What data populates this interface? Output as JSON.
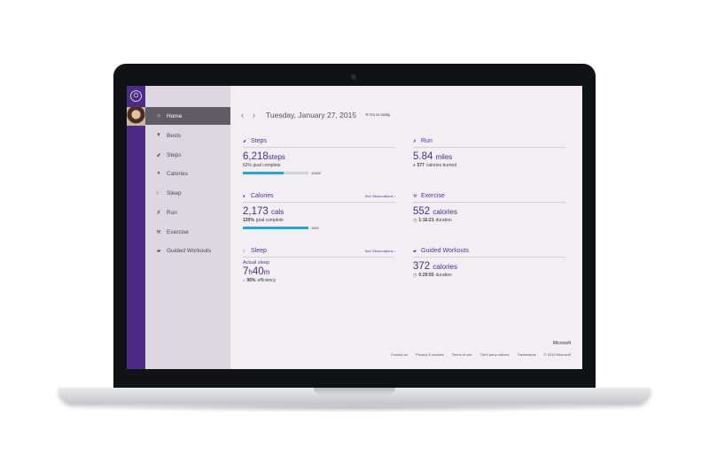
{
  "sidebar": {
    "rail_icon": "power-icon",
    "items": [
      {
        "label": "Home",
        "icon": "home-icon",
        "glyph": "⌂",
        "active": true
      },
      {
        "label": "Bests",
        "icon": "trophy-icon",
        "glyph": "🏆"
      },
      {
        "label": "Steps",
        "icon": "steps-icon",
        "glyph": "⬋"
      },
      {
        "label": "Calories",
        "icon": "flame-icon",
        "glyph": "♦"
      },
      {
        "label": "Sleep",
        "icon": "moon-icon",
        "glyph": "☾"
      },
      {
        "label": "Run",
        "icon": "run-icon",
        "glyph": "✗"
      },
      {
        "label": "Exercise",
        "icon": "dumbbell-icon",
        "glyph": "⚒"
      },
      {
        "label": "Guided Workouts",
        "icon": "clipboard-icon",
        "glyph": "▰"
      }
    ]
  },
  "header": {
    "prev": "‹",
    "next": "›",
    "date": "Tuesday, January 27, 2015",
    "today_link": "⟲ Go to today"
  },
  "cards": {
    "steps": {
      "title": "Steps",
      "value": "6,218",
      "unit": "steps",
      "goal_text": "62% goal complete",
      "goal_pct": "62%",
      "progress": 0.62,
      "goal": "10000"
    },
    "run": {
      "title": "Run",
      "value": "5.84",
      "unit": "miles",
      "sub_value": "577",
      "sub_text": "calories burned"
    },
    "calories": {
      "title": "Calories",
      "link": "See Observations ›",
      "value": "2,173",
      "unit": "cals",
      "goal_pct": "120%",
      "goal_text": "goal complete",
      "progress": 1.0,
      "goal": "1800"
    },
    "exercise": {
      "title": "Exercise",
      "value": "552",
      "unit": "calories",
      "sub_value": "1:16:21",
      "sub_text": "duration"
    },
    "sleep": {
      "title": "Sleep",
      "link": "See Observations ›",
      "label": "Actual sleep",
      "hours": "7",
      "h": "h",
      "minutes": "40",
      "m": "m",
      "sub_value": "96%",
      "sub_text": "efficiency"
    },
    "guided": {
      "title": "Guided Workouts",
      "value": "372",
      "unit": "calories",
      "sub_value": "0:29:55",
      "sub_text": "duration"
    }
  },
  "footer": {
    "brand": "Microsoft",
    "links": [
      "Contact us",
      "Privacy & cookies",
      "Terms of use",
      "Third party notices",
      "Trademarks",
      "© 2015 Microsoft"
    ]
  },
  "colors": {
    "accent": "#4b2b84",
    "progress": "#2aa3cf",
    "sidebar": "#dcd7e0",
    "active_nav": "#605c66"
  }
}
